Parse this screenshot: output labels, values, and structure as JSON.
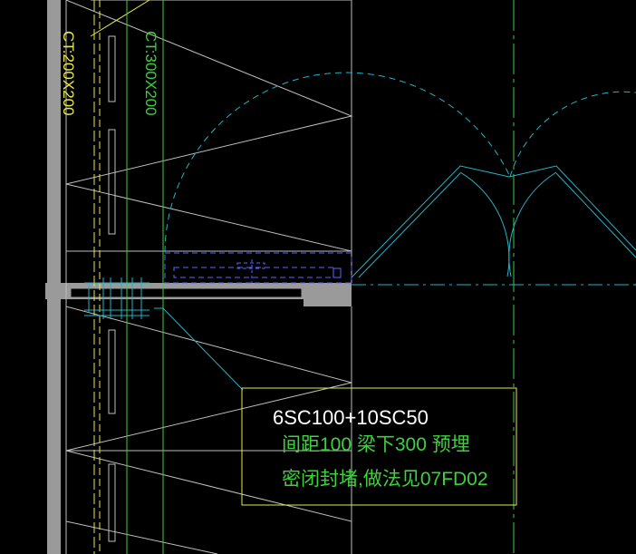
{
  "labels": {
    "ct_left": "CT:200X200",
    "ct_right": "CT:300X200"
  },
  "note": {
    "line1": "6SC100+10SC50",
    "line2": "间距100 梁下300 预埋",
    "line3": "密闭封堵,做法见07FD02"
  },
  "colors": {
    "background": "#000000",
    "gray_wall": "#9a9a9a",
    "thin_line": "#bdbdbd",
    "yellow": "#e8e84a",
    "green": "#3dd13d",
    "cyan": "#25b3c6",
    "blue": "#5a66ff",
    "white": "#ffffff"
  }
}
